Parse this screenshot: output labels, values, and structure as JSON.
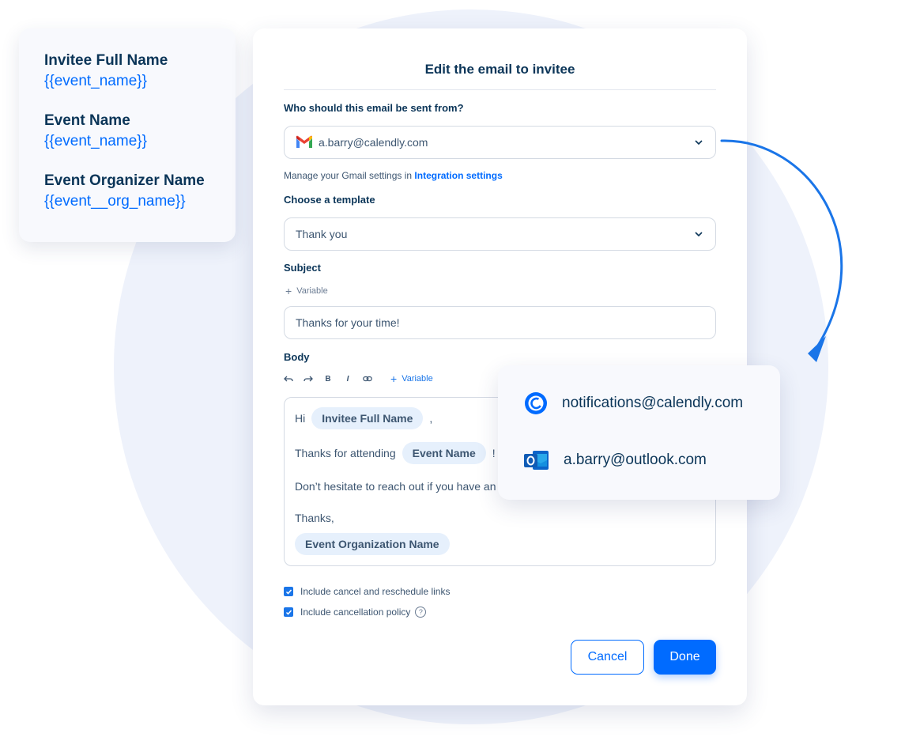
{
  "variables_card": {
    "items": [
      {
        "title": "Invitee Full Name",
        "token": "{{event_name}}"
      },
      {
        "title": "Event Name",
        "token": "{{event_name}}"
      },
      {
        "title": "Event Organizer Name",
        "token": "{{event__org_name}}"
      }
    ]
  },
  "dialog": {
    "title": "Edit the email to invitee",
    "from_label": "Who should this email be sent from?",
    "from_value": "a.barry@calendly.com",
    "manage_text": "Manage your Gmail settings in",
    "manage_link": "Integration settings",
    "template_label": "Choose a template",
    "template_value": "Thank you",
    "subject_label": "Subject",
    "subject_variable": "Variable",
    "subject_value": "Thanks for your time!",
    "body_label": "Body",
    "body_variable": "Variable",
    "toolbar": {
      "bold": "B",
      "italic": "I"
    },
    "body": {
      "greeting": "Hi",
      "chip_invitee": "Invitee Full Name",
      "comma": ",",
      "thanks_attending": "Thanks for attending",
      "chip_event": "Event Name",
      "exclaim": "!",
      "hesitate": "Don’t hesitate to reach out if you have an",
      "signoff": "Thanks,",
      "chip_org": "Event Organization Name"
    },
    "checkbox_cancel_links": "Include cancel and reschedule links",
    "checkbox_cancel_policy": "Include cancellation policy",
    "help_mark": "?",
    "cancel_button": "Cancel",
    "done_button": "Done"
  },
  "sender_options": [
    {
      "email": "notifications@calendly.com",
      "icon": "calendly-icon"
    },
    {
      "email": "a.barry@outlook.com",
      "icon": "outlook-icon"
    }
  ],
  "colors": {
    "accent": "#006bff",
    "text": "#0b3558",
    "chip_bg": "#e6f0fc"
  }
}
